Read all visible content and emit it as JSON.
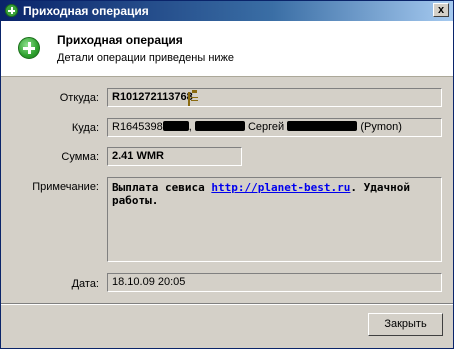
{
  "window": {
    "title": "Приходная операция",
    "close_label": "x"
  },
  "header": {
    "title": "Приходная операция",
    "subtitle": "Детали операции приведены ниже"
  },
  "fields": {
    "from": {
      "label": "Откуда:",
      "value": "R101272113768"
    },
    "to": {
      "label": "Куда:",
      "value_start": "R1645398",
      "value_mid": ",",
      "value_name": "Сергей",
      "value_end": "(Pymon)"
    },
    "amount": {
      "label": "Сумма:",
      "value": "2.41 WMR"
    },
    "note": {
      "label": "Примечание:",
      "text_before": "Выплата севиса ",
      "link": "http://planet-best.ru",
      "text_after": ". Удачной работы."
    },
    "date": {
      "label": "Дата:",
      "value": "18.10.09 20:05"
    }
  },
  "buttons": {
    "close": "Закрыть"
  },
  "icons": {
    "title_icon": "plus-circle-icon",
    "header_icon": "plus-circle-icon",
    "from_field_icon": "wallet-icon"
  },
  "colors": {
    "title_bar": "#0a246a",
    "header_bg": "#ffffff",
    "link": "#0000ee"
  }
}
